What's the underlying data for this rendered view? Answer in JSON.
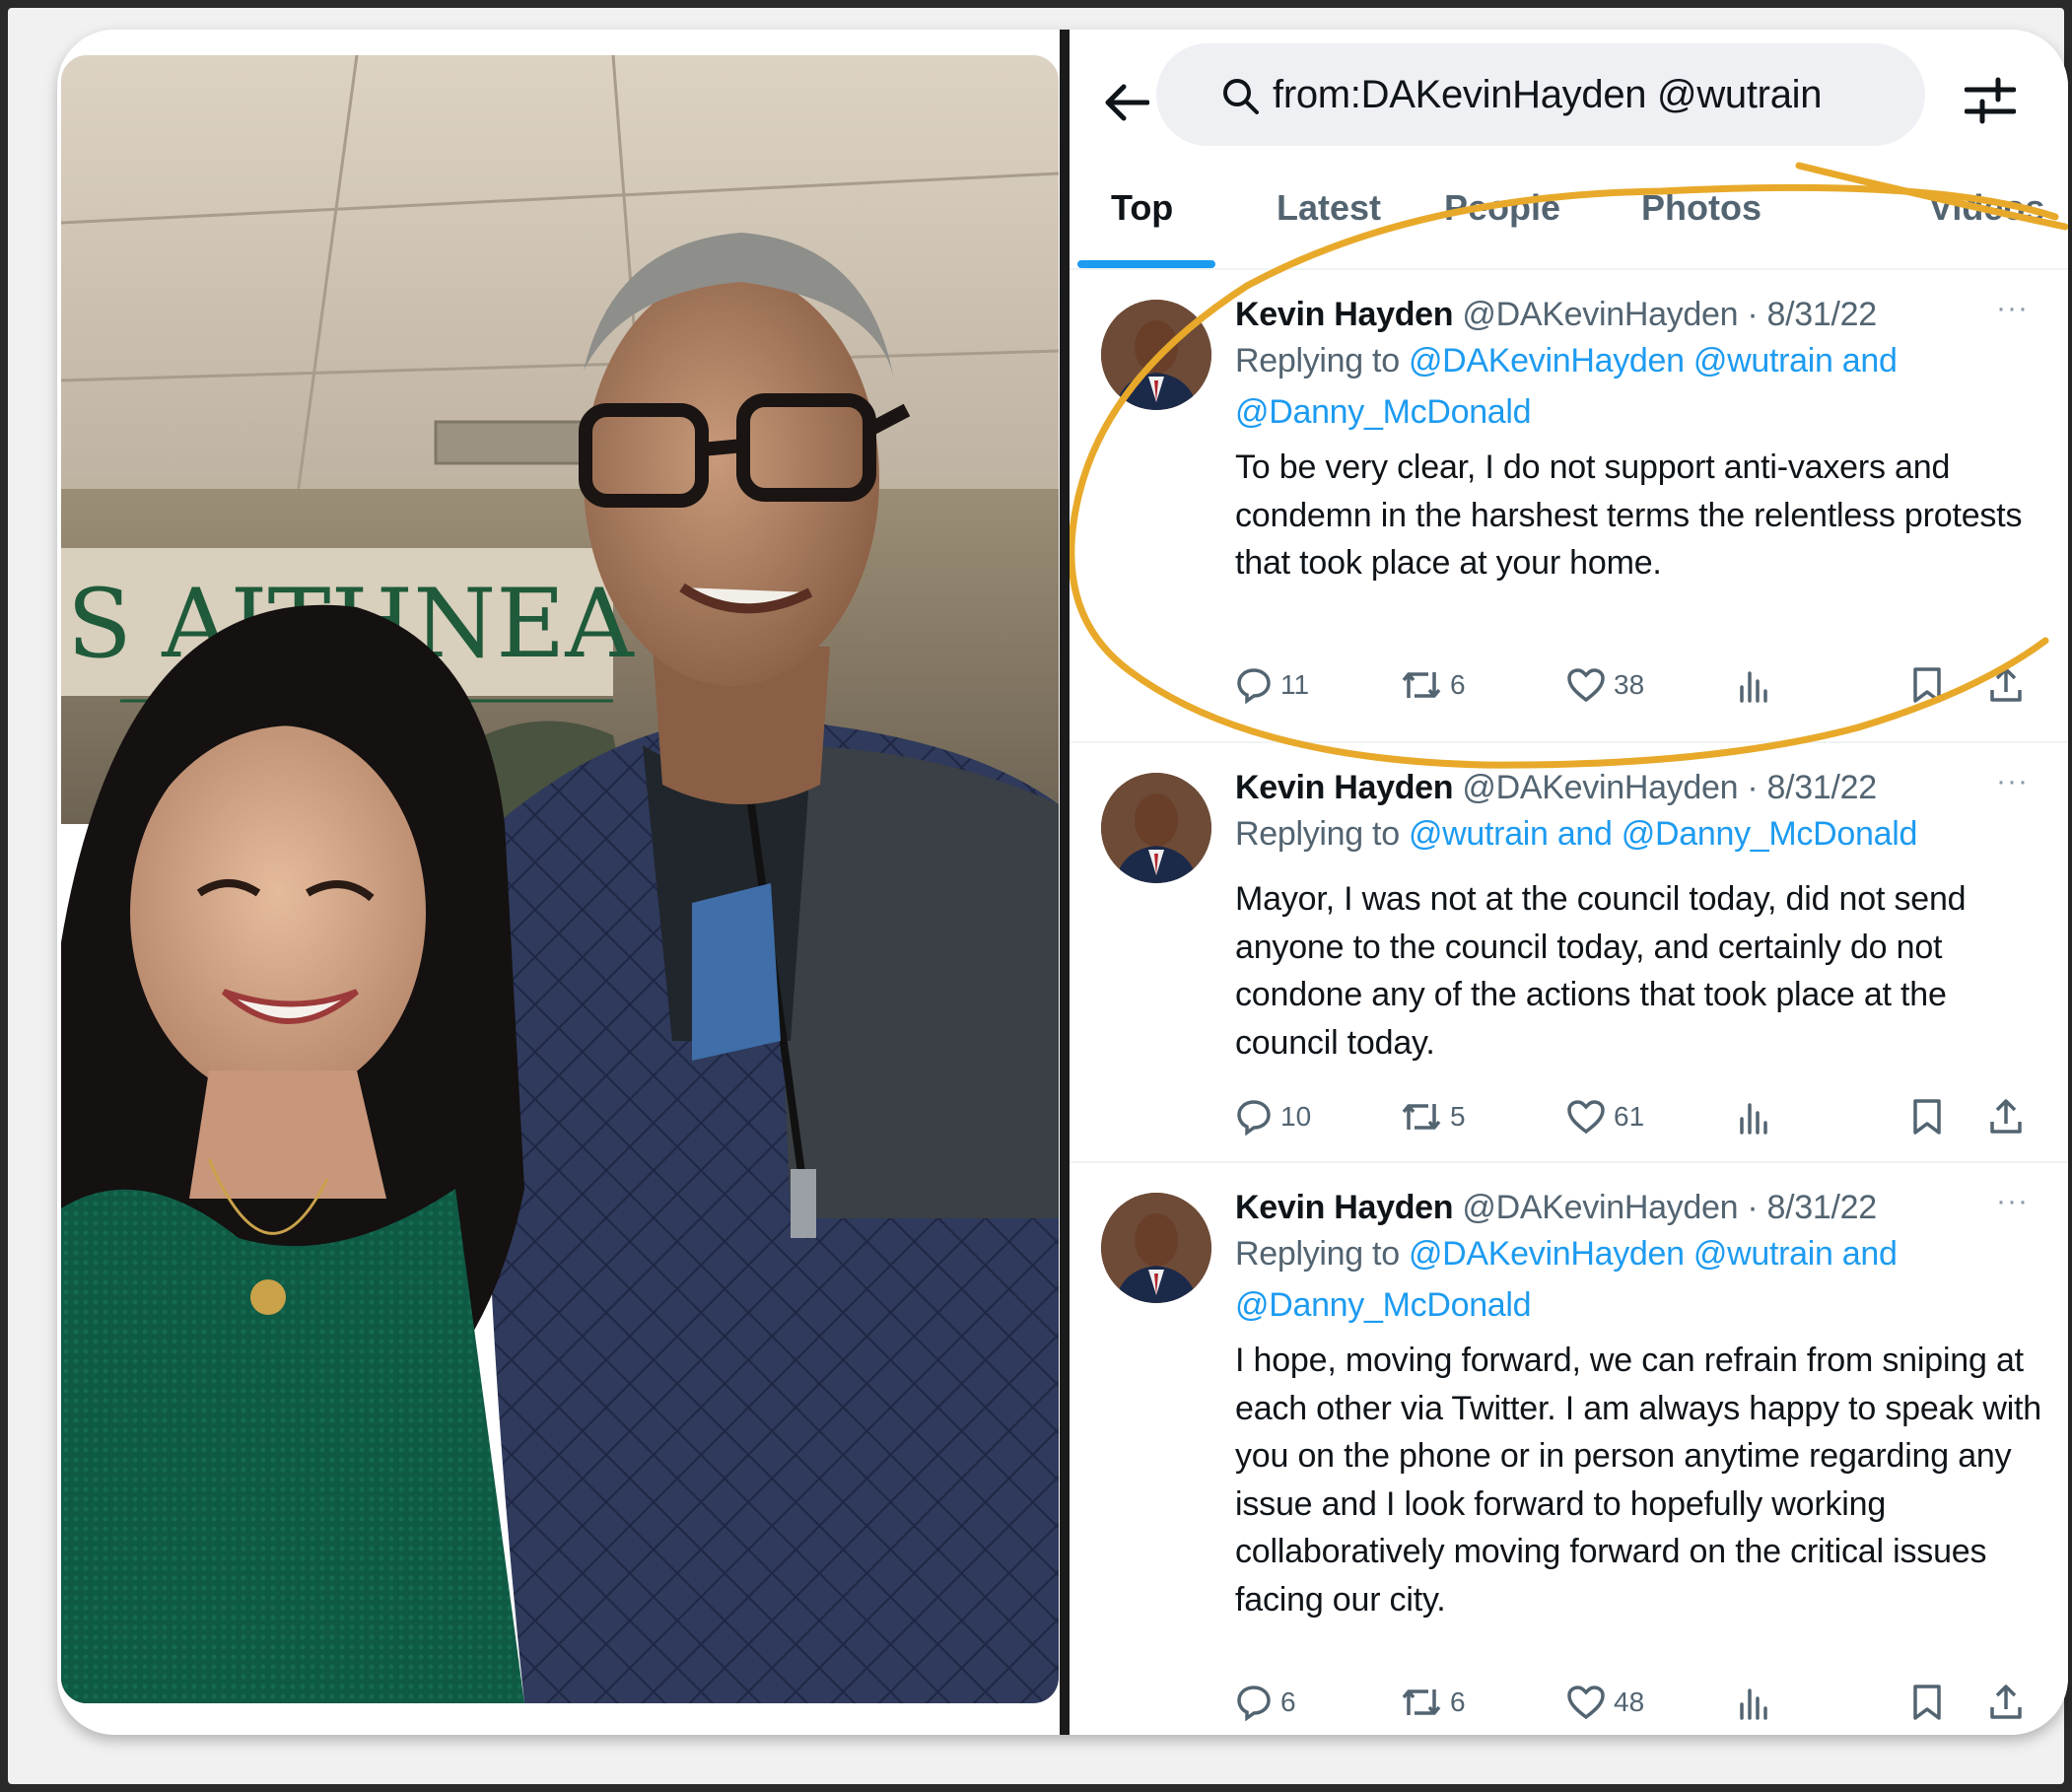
{
  "search": {
    "query": "from:DAKevinHayden @wutrain"
  },
  "tabs": [
    {
      "label": "Top",
      "active": true
    },
    {
      "label": "Latest",
      "active": false
    },
    {
      "label": "People",
      "active": false
    },
    {
      "label": "Photos",
      "active": false
    },
    {
      "label": "Videos",
      "active": false
    }
  ],
  "photo": {
    "sign_text": "S AITHNEAC"
  },
  "tweets": [
    {
      "name": "Kevin Hayden",
      "handle_date": "@DAKevinHayden · 8/31/22",
      "replying_prefix": "Replying to ",
      "replying_to": "@DAKevinHayden @wutrain and @Danny_McDonald",
      "text": "To be very clear, I do not support anti-vaxers and condemn in the harshest terms the relentless protests that took place at your home.",
      "replies": "11",
      "retweets": "6",
      "likes": "38",
      "more": "···"
    },
    {
      "name": "Kevin Hayden",
      "handle_date": "@DAKevinHayden · 8/31/22",
      "replying_prefix": "Replying to ",
      "replying_to": "@wutrain and @Danny_McDonald",
      "text": "Mayor, I was not at the council today, did not send anyone to the council today, and certainly do not condone any of the actions that took place at the council today.",
      "replies": "10",
      "retweets": "5",
      "likes": "61",
      "more": "···"
    },
    {
      "name": "Kevin Hayden",
      "handle_date": "@DAKevinHayden · 8/31/22",
      "replying_prefix": "Replying to ",
      "replying_to": "@DAKevinHayden @wutrain and @Danny_McDonald",
      "text": "I hope, moving forward, we can refrain from sniping at each other via Twitter. I am always happy to speak with you on the phone or in person anytime regarding any issue and I look forward to hopefully working collaboratively moving forward on the critical issues facing our city.",
      "replies": "6",
      "retweets": "6",
      "likes": "48",
      "more": "···"
    }
  ],
  "colors": {
    "accent": "#1d9bf0",
    "annotation": "#e8a92a",
    "text": "#0f1419",
    "muted": "#536471"
  },
  "icons": {
    "back": "arrow-left-icon",
    "search": "search-icon",
    "filter": "sliders-icon",
    "reply": "reply-icon",
    "retweet": "retweet-icon",
    "like": "heart-icon",
    "views": "views-icon",
    "bookmark": "bookmark-icon",
    "share": "share-icon"
  }
}
